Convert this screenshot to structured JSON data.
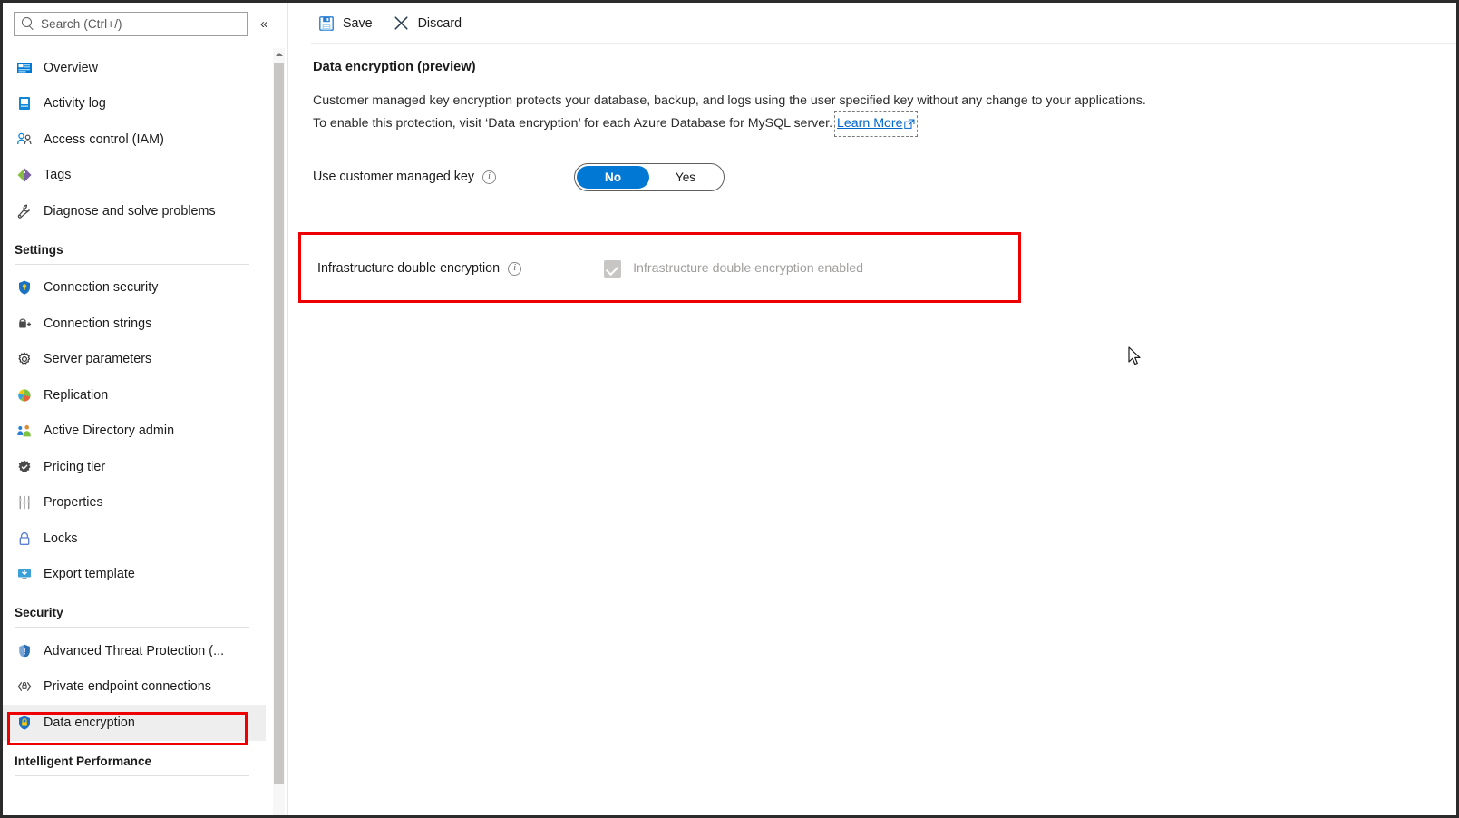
{
  "sidebar": {
    "search": {
      "placeholder": "Search (Ctrl+/)",
      "icon": "search-icon"
    },
    "collapse_label": "«",
    "items": [
      {
        "label": "Overview",
        "icon": "overview-icon",
        "selected": false
      },
      {
        "label": "Activity log",
        "icon": "activity-log-icon",
        "selected": false
      },
      {
        "label": "Access control (IAM)",
        "icon": "access-control-icon",
        "selected": false
      },
      {
        "label": "Tags",
        "icon": "tags-icon",
        "selected": false
      },
      {
        "label": "Diagnose and solve problems",
        "icon": "diagnose-icon",
        "selected": false
      }
    ],
    "groups": [
      {
        "title": "Settings",
        "items": [
          {
            "label": "Connection security",
            "icon": "shield-icon",
            "selected": false
          },
          {
            "label": "Connection strings",
            "icon": "connection-strings-icon",
            "selected": false
          },
          {
            "label": "Server parameters",
            "icon": "gear-icon",
            "selected": false
          },
          {
            "label": "Replication",
            "icon": "replication-icon",
            "selected": false
          },
          {
            "label": "Active Directory admin",
            "icon": "active-directory-icon",
            "selected": false
          },
          {
            "label": "Pricing tier",
            "icon": "pricing-tier-icon",
            "selected": false
          },
          {
            "label": "Properties",
            "icon": "properties-icon",
            "selected": false
          },
          {
            "label": "Locks",
            "icon": "lock-icon",
            "selected": false
          },
          {
            "label": "Export template",
            "icon": "export-template-icon",
            "selected": false
          }
        ]
      },
      {
        "title": "Security",
        "items": [
          {
            "label": "Advanced Threat Protection (...",
            "icon": "threat-protection-icon",
            "selected": false
          },
          {
            "label": "Private endpoint connections",
            "icon": "private-endpoint-icon",
            "selected": false
          },
          {
            "label": "Data encryption",
            "icon": "data-encryption-icon",
            "selected": true
          }
        ]
      },
      {
        "title": "Intelligent Performance",
        "items": []
      }
    ]
  },
  "toolbar": {
    "save_label": "Save",
    "save_icon": "save-disk-icon",
    "discard_label": "Discard",
    "discard_icon": "close-x-icon"
  },
  "main": {
    "section_title": "Data encryption (preview)",
    "description_part1": "Customer managed key encryption protects your database, backup, and logs using the user specified key without any change to your applications. To enable this protection, visit ‘Data encryption’ for each Azure Database for MySQL server. ",
    "learn_more_label": "Learn More",
    "learn_more_icon": "external-link-icon",
    "cmk": {
      "label": "Use customer managed key",
      "info_icon": "info-icon",
      "option_no": "No",
      "option_yes": "Yes",
      "selected": "No"
    },
    "infrastructure": {
      "label": "Infrastructure double encryption",
      "info_icon": "info-icon",
      "checkbox_label": "Infrastructure double encryption enabled",
      "checkbox_checked": true,
      "checkbox_disabled": true
    }
  },
  "annotations": {
    "highlight_color": "#ee0000",
    "highlighted_sidebar_item": "Data encryption",
    "highlighted_section": "Infrastructure double encryption"
  },
  "theme": {
    "accent": "#0078d4",
    "link": "#0066cc",
    "selected_bg": "#eeeeee",
    "border": "#e6e6e6"
  }
}
